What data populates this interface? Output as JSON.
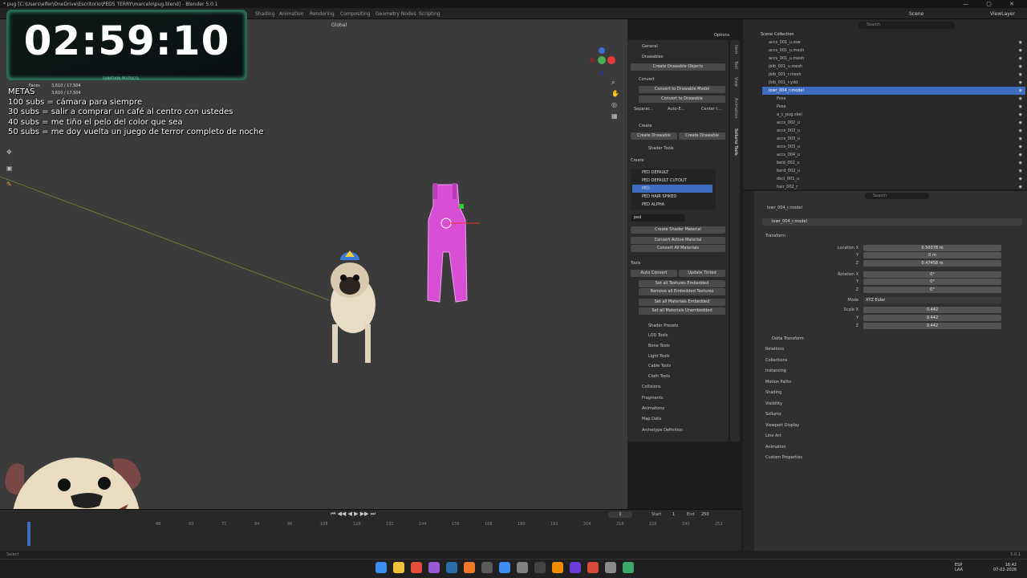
{
  "window": {
    "title": "* pug [C:\\Users\\elfer\\OneDrive\\Escritorio\\PEDS TERRY\\marcelo\\pug.blend] - Blender 5.0.1",
    "controls": "— ▢ ✕"
  },
  "workspaces": [
    "Shading",
    "Animation",
    "Rendering",
    "Compositing",
    "Geometry Nodes",
    "Scripting"
  ],
  "scene": {
    "scene_label": "Scene",
    "viewlayer_label": "ViewLayer",
    "search_placeholder": "Search"
  },
  "viewport_header": {
    "orientation": "Global",
    "options": "Options"
  },
  "overlay": {
    "timer": "02:59:10",
    "timer_caption": "SUBATHON PROTOCOL",
    "goals_title": "METAS",
    "goals": [
      "100 subs = cámara para siempre",
      "30 subs = salir a comprar un café al centro con ustedes",
      "40 subs = me tiño el pelo del color que sea",
      "50 subs = me doy vuelta un juego de terror completo de noche"
    ],
    "stats_faces": "Faces",
    "stats_faces_val": "3,610 / 17,504",
    "stats_tris_val": "3,610 / 17,504"
  },
  "npanel": {
    "general": "General",
    "drawables": "Drawables",
    "create_drawable_objects": "Create Drawable Objects",
    "convert": "Convert",
    "convert_to_drawable_model": "Convert to Drawable Model",
    "convert_to_drawable": "Convert to Drawable",
    "separate": "Separat...",
    "auto_e": "Auto-E...",
    "center": "Center t...",
    "create": "Create",
    "create_drawable_1": "Create Drawable",
    "create_drawable_2": "Create Drawable",
    "shader_tools": "Shader Tools",
    "create_header": "Create",
    "shader_list": [
      "PED DEFAULT",
      "PED DEFAULT CUTOUT",
      "PED",
      "PED HAIR SPIKED",
      "PED ALPHA"
    ],
    "filter_value": "ped",
    "create_shader_material": "Create Shader Material",
    "convert_active_material": "Convert Active Material",
    "convert_all_materials": "Convert All Materials",
    "tools": "Tools",
    "auto_convert": "Auto Convert",
    "update_tinted": "Update Tinted",
    "set_all_textures_embedded": "Set all Textures Embedded",
    "remove_all_embedded_textures": "Remove all Embedded Textures",
    "set_all_materials_embedded": "Set all Materials Embedded",
    "set_all_materials_unembedded": "Set all Materials Unembedded",
    "subsections": [
      "Shader Presets",
      "LOD Tools",
      "Bone Tools",
      "Light Tools",
      "Cable Tools",
      "Cloth Tools"
    ],
    "sections": [
      "Collisions",
      "Fragments",
      "Animations",
      "Map Data",
      "Archetype Definition"
    ]
  },
  "vtabs": [
    "Item",
    "Tool",
    "View",
    "Animation",
    "Sollumz Tools"
  ],
  "outliner": {
    "root": "Scene Collection",
    "rows": [
      {
        "name": "accs_001_u.ssw",
        "selected": false
      },
      {
        "name": "accs_001_u.mesh",
        "selected": false
      },
      {
        "name": "accs_001_u.mesh",
        "selected": false
      },
      {
        "name": "jbib_001_u.mesh",
        "selected": false
      },
      {
        "name": "jbib_001_r.mesh",
        "selected": false
      },
      {
        "name": "jbib_001_r.ydd",
        "selected": false
      },
      {
        "name": "lowr_004_r.model",
        "selected": true
      },
      {
        "name": "Pose",
        "selected": false
      },
      {
        "name": "Pose",
        "selected": false
      },
      {
        "name": "a_c_pug.skel",
        "selected": false
      },
      {
        "name": "accs_002_u",
        "selected": false
      },
      {
        "name": "accs_003_u",
        "selected": false
      },
      {
        "name": "accs_003_u",
        "selected": false
      },
      {
        "name": "accs_003_u",
        "selected": false
      },
      {
        "name": "accs_004_u",
        "selected": false
      },
      {
        "name": "beld_002_u",
        "selected": false
      },
      {
        "name": "berd_002_u",
        "selected": false
      },
      {
        "name": "decl_001_u",
        "selected": false
      },
      {
        "name": "hair_002_r",
        "selected": false
      }
    ]
  },
  "properties": {
    "object_name": "lowr_004_r.model",
    "object_name_field": "lowr_004_r.model",
    "transform": "Transform",
    "location_label": "Location X",
    "location": [
      "0.50378 m",
      "0 m",
      "0.47458 m"
    ],
    "rotation_label": "Rotation X",
    "rotation": [
      "0°",
      "0°",
      "0°"
    ],
    "mode_label": "Mode",
    "mode_value": "XYZ Euler",
    "scale_label": "Scale X",
    "scale": [
      "0.442",
      "0.442",
      "0.442"
    ],
    "axis_y": "Y",
    "axis_z": "Z",
    "delta_transform": "Delta Transform",
    "sections": [
      "Relations",
      "Collections",
      "Instancing",
      "Motion Paths",
      "Shading",
      "Visibility",
      "Sollumz",
      "Viewport Display",
      "Line Art",
      "Animation",
      "Custom Properties"
    ]
  },
  "timeline": {
    "frame": "1",
    "start_label": "Start",
    "start": "1",
    "end_label": "End",
    "end": "250",
    "ruler": [
      "48",
      "60",
      "72",
      "84",
      "96",
      "108",
      "120",
      "132",
      "144",
      "156",
      "168",
      "180",
      "192",
      "204",
      "216",
      "228",
      "240",
      "252"
    ]
  },
  "statusbar": {
    "left": "Select",
    "right": "5.0.1"
  },
  "taskbar": {
    "lang": "ESP",
    "lang2": "LAA",
    "time": "16:42",
    "date": "07-02-2026",
    "icons": [
      "windows-icon",
      "files-icon",
      "chrome-icon",
      "app1-icon",
      "steam-icon",
      "app2-icon",
      "obs-icon",
      "browser-icon",
      "settings-icon",
      "terminal-icon",
      "blender-icon",
      "app3-icon",
      "app4-icon",
      "app5-icon",
      "app6-icon"
    ]
  }
}
